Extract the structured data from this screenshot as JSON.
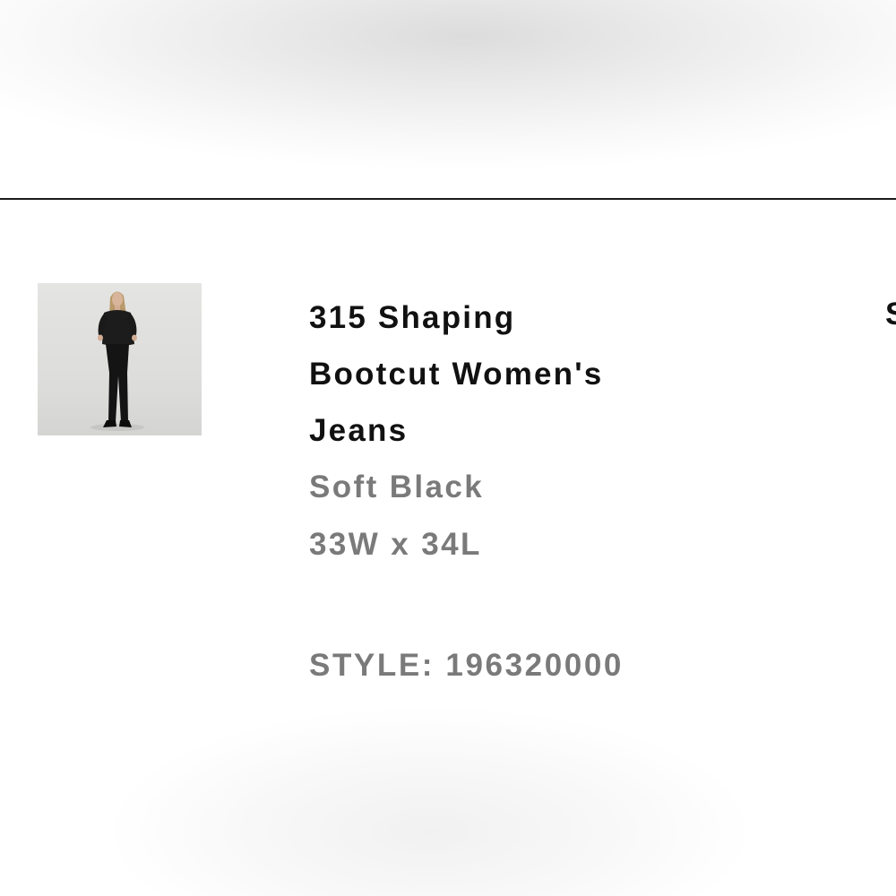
{
  "product": {
    "name_lines": [
      "315 Shaping",
      "Bootcut Women's",
      "Jeans"
    ],
    "color": "Soft Black",
    "size": "33W x 34L",
    "style": "STYLE: 196320000",
    "image_alt": "Model wearing 315 Shaping Bootcut Women's Jeans in Soft Black"
  },
  "edge_cropped_text": "S",
  "colors": {
    "title_text": "#111111",
    "secondary_text": "#7a7a7a",
    "divider": "#1a1a1a",
    "thumb_background": "#dedede"
  },
  "icons": {
    "thumbnail": "product-photo"
  }
}
